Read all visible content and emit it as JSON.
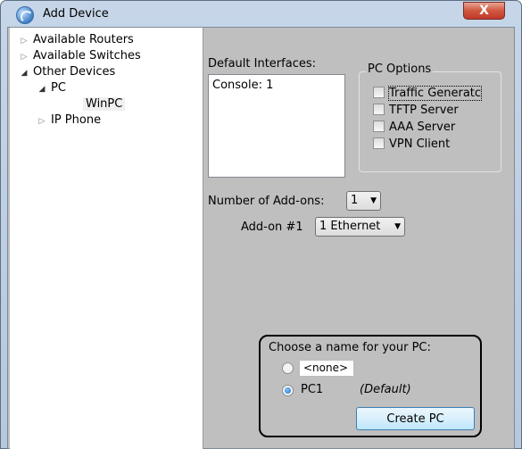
{
  "window": {
    "title": "Add Device",
    "close_glyph": "X",
    "app_icon": "packet-tracer-icon"
  },
  "tree": {
    "items": [
      {
        "label": "Available Routers",
        "arrow": "▷"
      },
      {
        "label": "Available Switches",
        "arrow": "▷"
      },
      {
        "label": "Other Devices",
        "arrow": "◢"
      },
      {
        "label": "PC",
        "arrow": "◢"
      },
      {
        "label": "WinPC",
        "arrow": ""
      },
      {
        "label": "IP Phone",
        "arrow": "▷"
      }
    ]
  },
  "interfaces": {
    "label": "Default Interfaces:",
    "items": [
      "Console: 1"
    ]
  },
  "pc_options": {
    "title": "PC Options",
    "items": [
      {
        "label": "Traffic Generatc",
        "checked": false
      },
      {
        "label": "TFTP Server",
        "checked": false
      },
      {
        "label": "AAA Server",
        "checked": false
      },
      {
        "label": "VPN Client",
        "checked": false
      }
    ]
  },
  "addons": {
    "count_label": "Number of Add-ons:",
    "count_value": "1",
    "addon_label": "Add-on #1",
    "addon_value": "1 Ethernet"
  },
  "naming": {
    "title": "Choose a name for your PC:",
    "custom_value": "<none>",
    "default_name": "PC1",
    "default_note": "(Default)",
    "create_label": "Create PC"
  },
  "colors": {
    "panel_bg": "#bfbfbf",
    "frame": "#c6d6e8",
    "close": "#c0392b"
  }
}
